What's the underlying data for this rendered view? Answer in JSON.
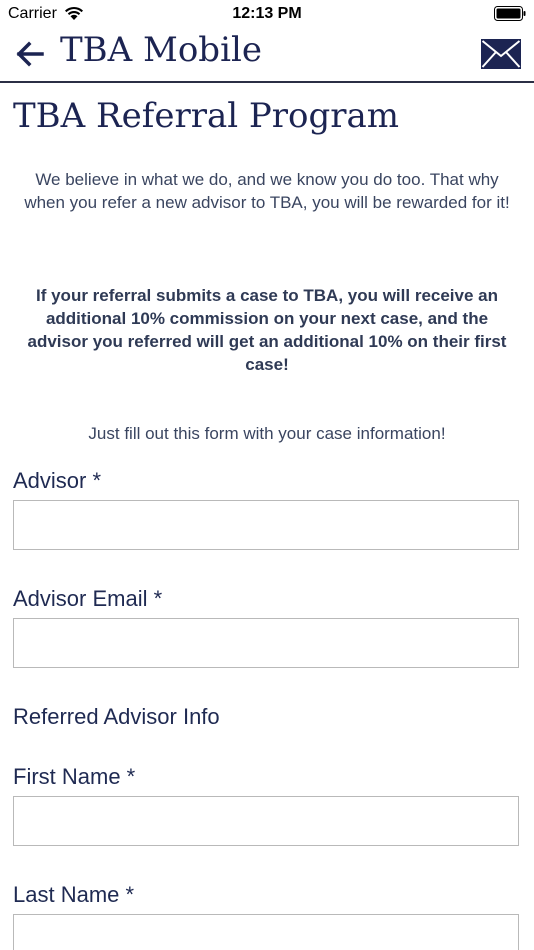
{
  "status": {
    "carrier": "Carrier",
    "time": "12:13 PM"
  },
  "nav": {
    "title": "TBA Mobile",
    "back_icon": "arrow-left-icon",
    "mail_icon": "envelope-icon"
  },
  "page": {
    "title": "TBA Referral Program",
    "intro": "We believe in what we do, and we know you do too. That why when you refer a new advisor to TBA, you will be rewarded for it!",
    "bold_text": "If your referral submits a case to TBA, you will receive an additional 10% commission on your next case, and the advisor you referred will get an additional 10% on their first case!",
    "fill_note": "Just fill out this form with your case information!"
  },
  "form": {
    "advisor_label": "Advisor *",
    "advisor_value": "",
    "advisor_email_label": "Advisor Email *",
    "advisor_email_value": "",
    "referred_section": "Referred Advisor Info",
    "first_name_label": "First Name *",
    "first_name_value": "",
    "last_name_label": "Last Name *",
    "last_name_value": ""
  },
  "colors": {
    "brand_navy": "#1c2452",
    "text_gray": "#3a4560",
    "border": "#b9b9b9"
  }
}
